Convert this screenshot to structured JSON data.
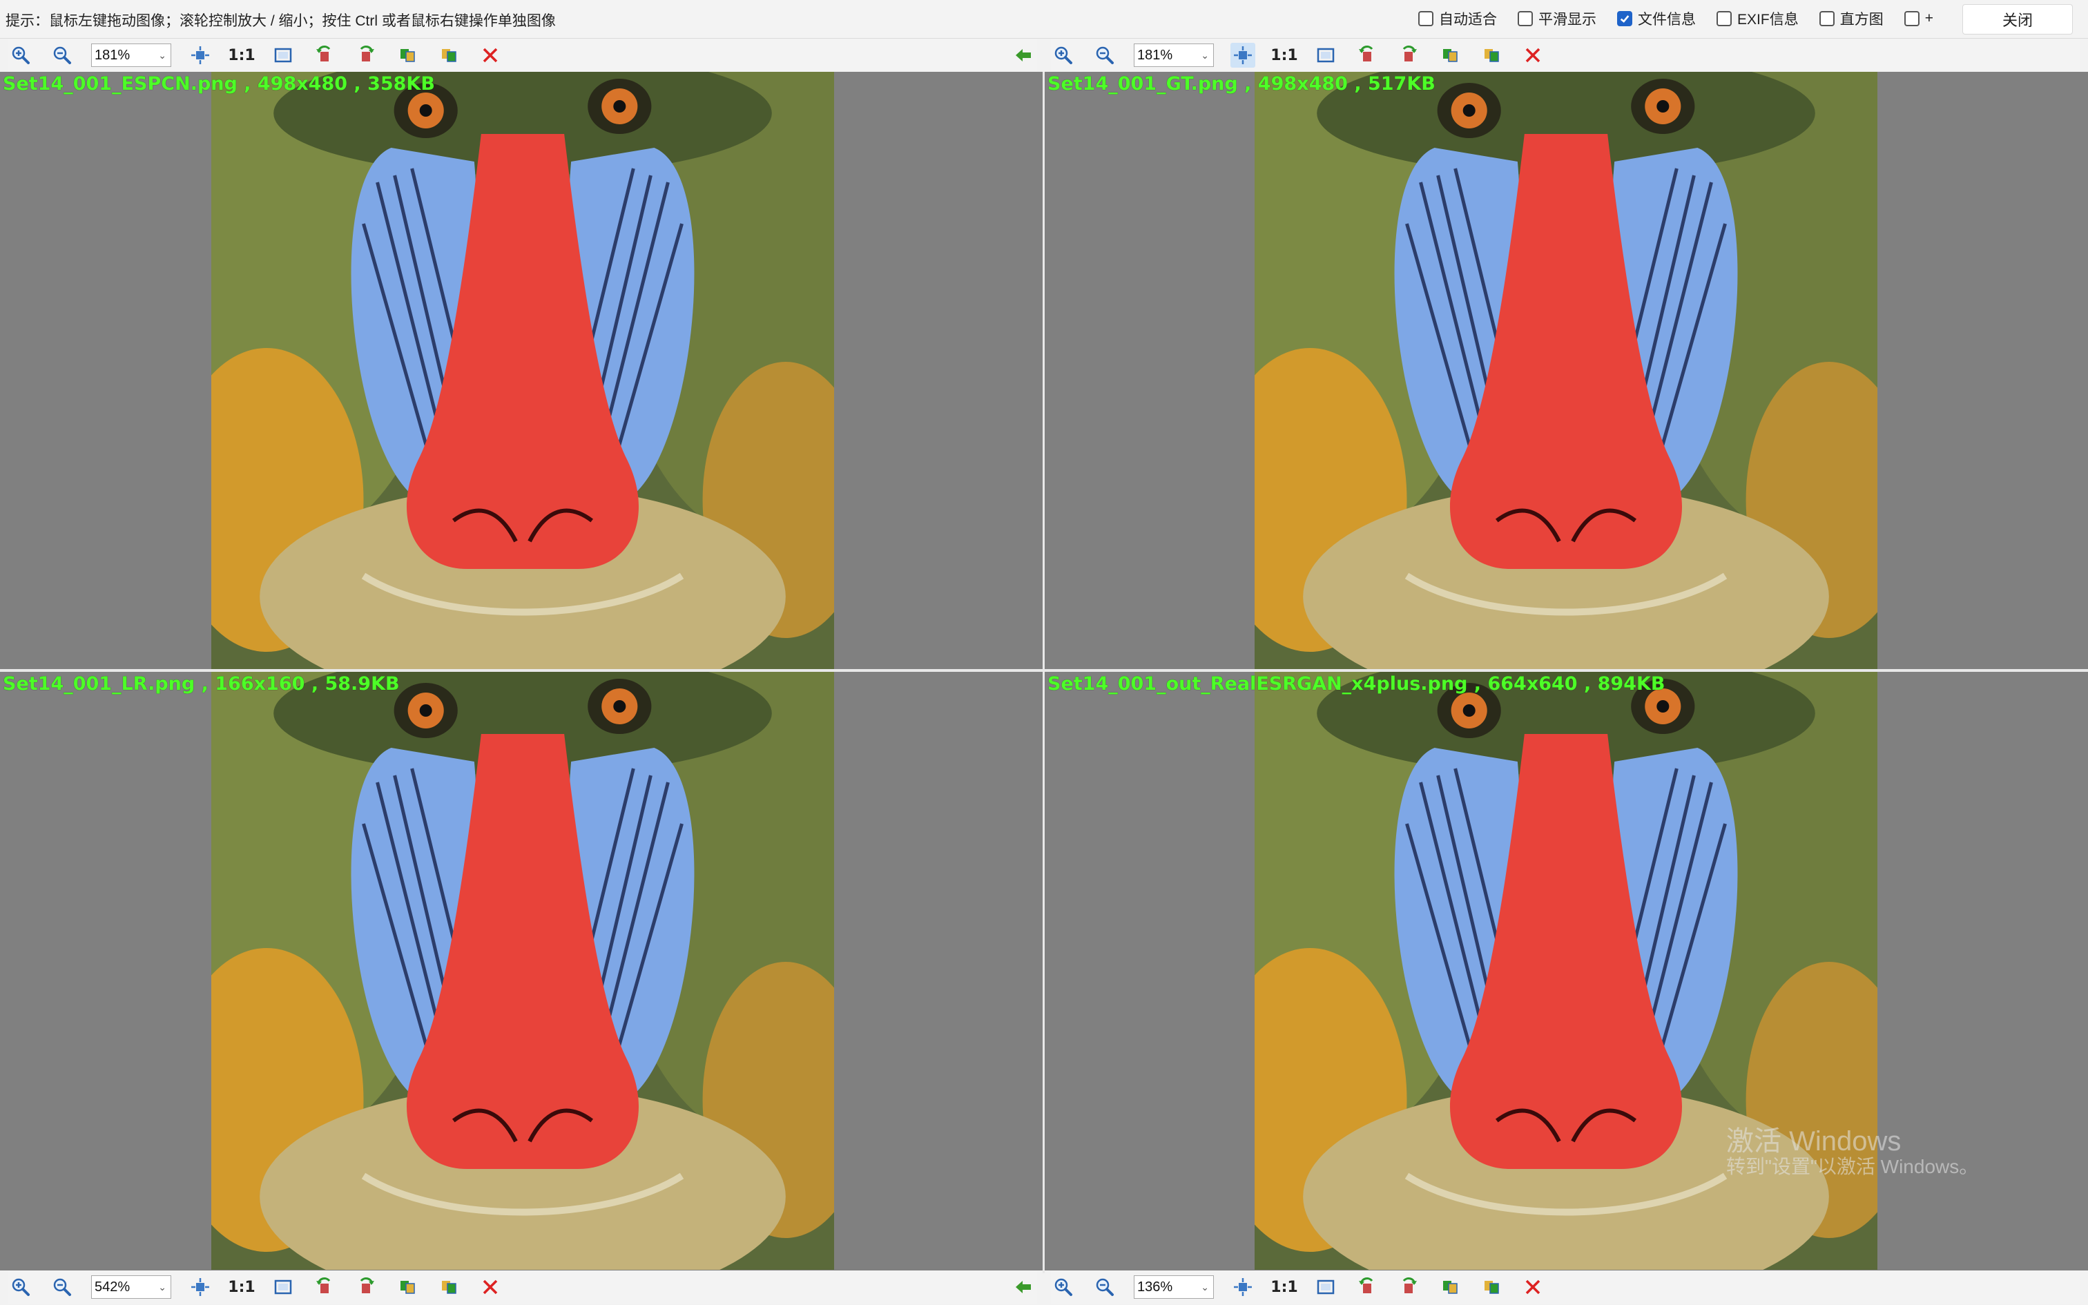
{
  "hint": "提示：鼠标左键拖动图像；滚轮控制放大 / 缩小；按住 Ctrl 或者鼠标右键操作单独图像",
  "options": [
    {
      "label": "自动适合",
      "checked": false
    },
    {
      "label": "平滑显示",
      "checked": false
    },
    {
      "label": "文件信息",
      "checked": true
    },
    {
      "label": "EXIF信息",
      "checked": false
    },
    {
      "label": "直方图",
      "checked": false
    },
    {
      "label": "+",
      "checked": false
    }
  ],
  "close_label": "关闭",
  "one_to_one": "1:1",
  "toolbars": {
    "top_left": {
      "zoom": "181%"
    },
    "top_right": {
      "zoom": "181%"
    },
    "bottom_left": {
      "zoom": "542%"
    },
    "bottom_right": {
      "zoom": "136%"
    }
  },
  "panes": {
    "top_left": {
      "label": "Set14_001_ESPCN.png , 498x480 , 358KB"
    },
    "top_right": {
      "label": "Set14_001_GT.png , 498x480 , 517KB"
    },
    "bottom_left": {
      "label": "Set14_001_LR.png , 166x160 , 58.9KB"
    },
    "bottom_right": {
      "label": "Set14_001_out_RealESRGAN_x4plus.png , 664x640 , 894KB"
    }
  },
  "watermark": {
    "line1": "激活 Windows",
    "line2": "转到\"设置\"以激活 Windows。"
  },
  "colors": {
    "label_green": "#4dff27",
    "pane_gray": "#808080",
    "accent_blue": "#1e63c9"
  }
}
